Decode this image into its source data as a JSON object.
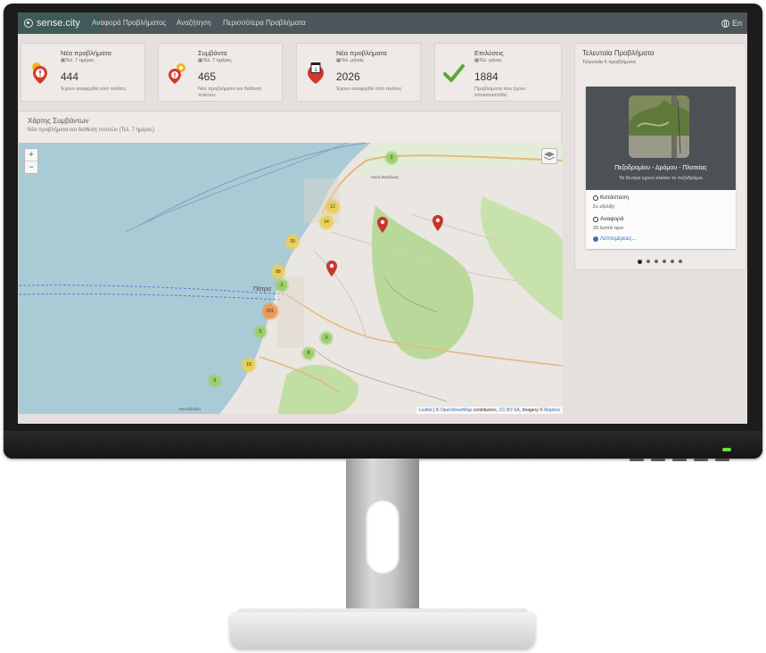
{
  "app": {
    "brand": "sense.city"
  },
  "nav": {
    "items": [
      "Αναφορά Προβλήματος",
      "Αναζήτηση",
      "Περισσότερα Προβλήματα"
    ],
    "language": "En"
  },
  "stats": [
    {
      "title": "Νέα προβλήματα",
      "period": "Τελ. 7 ημέρες",
      "value": "444",
      "desc": "Έχουν αναφερθεί από πολίτες",
      "icon": "alert-pin-icon"
    },
    {
      "title": "Συμβάντα",
      "period": "Τελ. 7 ημέρες",
      "value": "465",
      "desc": "Νέα προβλήματα και διάθεση πολιτών",
      "icon": "events-icon"
    },
    {
      "title": "Νέα προβλήματα",
      "period": "Τελ. μήνας",
      "value": "2026",
      "desc": "Έχουν αναφερθεί από πολίτες",
      "icon": "calendar-pin-icon"
    },
    {
      "title": "Επιλύσεις",
      "period": "Τελ. μήνας",
      "value": "1884",
      "desc": "Προβλήματα που έχουν αποκατασταθεί",
      "icon": "checkmark-icon"
    }
  ],
  "map_panel": {
    "title": "Χάρτης Συμβάντων",
    "subtitle": "Νέα προβλήματα και διάθεση πολιτών (Τελ. 7 ημέρες)",
    "zoom_in": "+",
    "zoom_out": "−",
    "city_label": "Πάτρα",
    "place_labels": [
      "Άγιος Βασίλειος",
      "Μονοδένδρι"
    ],
    "attribution": {
      "leaflet": "Leaflet",
      "osm_prefix": "| ©",
      "osm": "OpenStreetMap",
      "contrib": "contributors,",
      "license": "CC-BY-SA",
      "imagery": ", Imagery ©",
      "mapbox": "Mapbox"
    },
    "clusters": [
      "3",
      "12",
      "14",
      "39",
      "88",
      "2",
      "201",
      "5",
      "3",
      "8",
      "18",
      "6"
    ]
  },
  "latest": {
    "title": "Τελευταία Προβλήματα",
    "subtitle": "Τελευταία 6 προβλήματα",
    "card": {
      "caption": "Πεζοδρομίου - Δρόμου - Πλατείας",
      "caption_sub": "Τα δεντρα εχουν κλείσει το πεζοδρόμιο",
      "status_label": "Κατάσταση",
      "status_value": "Σε εξέλιξη",
      "report_label": "Αναφορά",
      "report_value": "20 λεπτά πριν",
      "more": "Λεπτομέρειες..."
    },
    "slides": 6,
    "active_slide": 1
  }
}
